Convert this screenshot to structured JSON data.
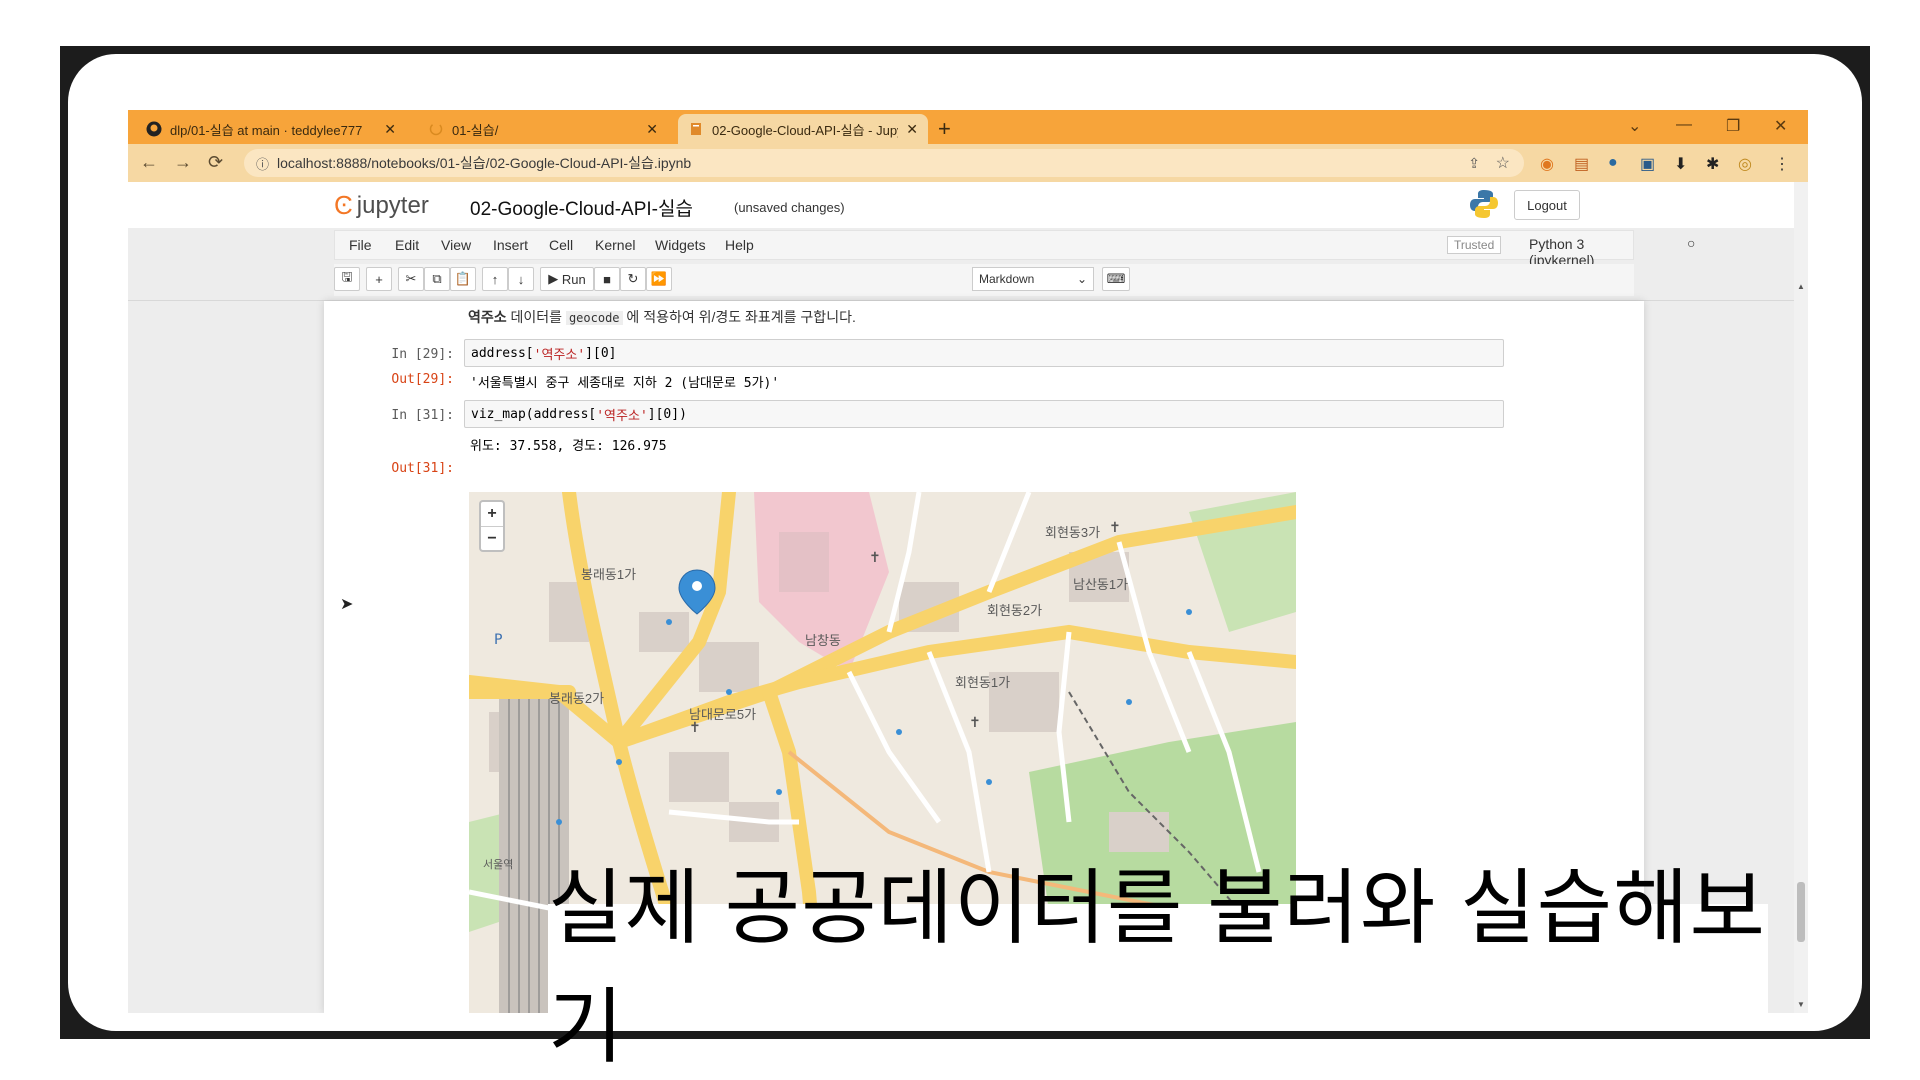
{
  "browser": {
    "tabs": [
      {
        "label": "dlp/01-실습 at main · teddylee777",
        "icon": "github-icon",
        "active": false
      },
      {
        "label": "01-실습/",
        "icon": "loading-icon",
        "active": false
      },
      {
        "label": "02-Google-Cloud-API-실습 - Jupyter",
        "icon": "notebook-icon",
        "active": true
      }
    ],
    "new_tab": "+",
    "url": "localhost:8888/notebooks/01-실습/02-Google-Cloud-API-실습.ipynb"
  },
  "jupyter": {
    "logo_text": "jupyter",
    "notebook_name": "02-Google-Cloud-API-실습",
    "unsaved": "(unsaved changes)",
    "logout": "Logout",
    "menu": [
      "File",
      "Edit",
      "View",
      "Insert",
      "Cell",
      "Kernel",
      "Widgets",
      "Help"
    ],
    "trusted": "Trusted",
    "kernel": "Python 3 (ipykernel)",
    "toolbar": {
      "run": "Run",
      "cell_type": "Markdown"
    }
  },
  "cells": {
    "markdown": {
      "bold": "역주소",
      "text1": " 데이터를 ",
      "code": "geocode",
      "text2": " 에 적용하여 위/경도 좌표계를 구합니다."
    },
    "in29": {
      "prompt": "In [29]:",
      "code_pre": "address[",
      "code_str": "'역주소'",
      "code_post": "][0]"
    },
    "out29": {
      "prompt": "Out[29]:",
      "text": "'서울특별시 중구 세종대로 지하 2 (남대문로 5가)'"
    },
    "in31": {
      "prompt": "In [31]:",
      "code_pre": "viz_map(address[",
      "code_str": "'역주소'",
      "code_post": "][0])"
    },
    "print31": {
      "text": "위도: 37.558, 경도: 126.975"
    },
    "out31": {
      "prompt": "Out[31]:"
    }
  },
  "map": {
    "zoom_in": "+",
    "zoom_out": "−",
    "labels": [
      {
        "text": "봉래동1가"
      },
      {
        "text": "봉래동2가"
      },
      {
        "text": "남창동"
      },
      {
        "text": "남대문로5가"
      },
      {
        "text": "회현동3가"
      },
      {
        "text": "남산동1가"
      },
      {
        "text": "회현동2가"
      },
      {
        "text": "회현동1가"
      },
      {
        "text": "서울역"
      }
    ],
    "colors": {
      "land": "#efe9df",
      "road_major": "#f8d36b",
      "road": "#ffffff",
      "park": "#b7dba0",
      "building": "#d9d0c9",
      "pink": "#f2c7cf",
      "rail": "#9b9b9b",
      "marker": "#3a8fd6"
    }
  },
  "caption": "실제 공공데이터를 불러와 실습해보기"
}
